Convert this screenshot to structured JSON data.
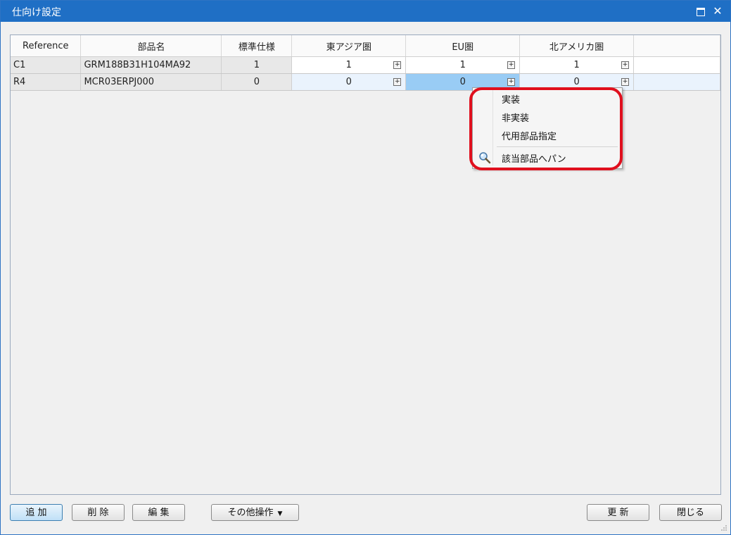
{
  "window": {
    "title": "仕向け設定"
  },
  "table": {
    "headers": [
      "Reference",
      "部品名",
      "標準仕様",
      "東アジア圏",
      "EU圏",
      "北アメリカ圏"
    ],
    "rows": [
      {
        "ref": "C1",
        "part": "GRM188B31H104MA92",
        "std": "1",
        "east_asia": "1",
        "eu": "1",
        "north_america": "1"
      },
      {
        "ref": "R4",
        "part": "MCR03ERPJ000",
        "std": "0",
        "east_asia": "0",
        "eu": "0",
        "north_america": "0"
      }
    ]
  },
  "context_menu": {
    "items": [
      "実装",
      "非実装",
      "代用部品指定",
      "該当部品へパン"
    ]
  },
  "buttons": {
    "add": "追 加",
    "delete": "削 除",
    "edit": "編 集",
    "other": "その他操作",
    "update": "更 新",
    "close": "閉じる"
  },
  "colors": {
    "titlebar": "#1f6fc5",
    "selected_cell": "#99ccf5",
    "highlight": "#e0101e"
  }
}
